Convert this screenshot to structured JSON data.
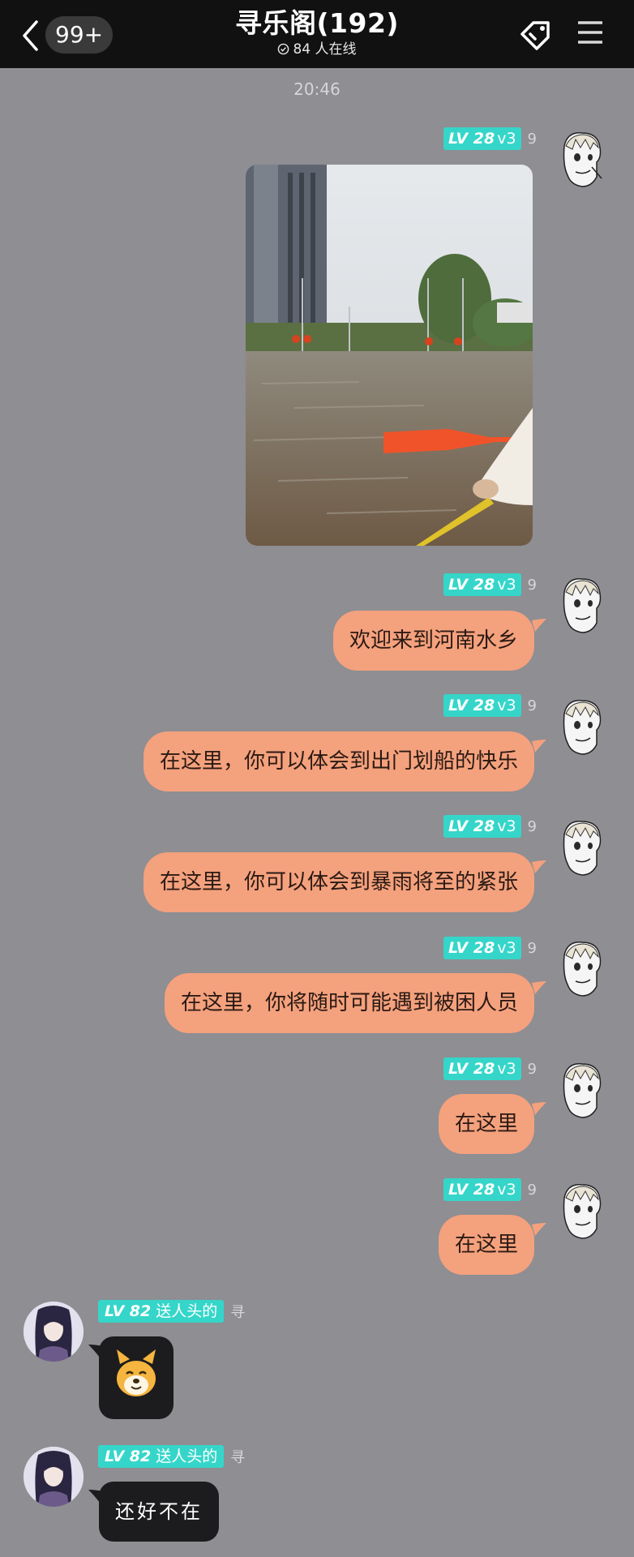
{
  "header": {
    "unread_badge": "99+",
    "title": "寻乐阁(192)",
    "online_text": "84 人在线"
  },
  "timestamp": "20:46",
  "sender_right": {
    "level": "LV 28",
    "sub": "v3",
    "num": "9"
  },
  "messages_right": [
    {
      "type": "image",
      "alt": "flooded street photo"
    },
    {
      "type": "text",
      "text": "欢迎来到河南水乡"
    },
    {
      "type": "text",
      "text": "在这里，你可以体会到出门划船的快乐"
    },
    {
      "type": "text",
      "text": "在这里，你可以体会到暴雨将至的紧张"
    },
    {
      "type": "text",
      "text": "在这里，你将随时可能遇到被困人员"
    },
    {
      "type": "text",
      "text": "在这里"
    },
    {
      "type": "text",
      "text": "在这里"
    }
  ],
  "sender_left": {
    "level": "LV 82",
    "name": "送人头的",
    "tag": "寻"
  },
  "messages_left": [
    {
      "type": "emoji",
      "name": "shiba-dog-emoji"
    },
    {
      "type": "text",
      "text": "还好不在"
    }
  ],
  "colors": {
    "background": "#8e8e93",
    "topbar": "#111111",
    "bubble_right": "#f4a17d",
    "bubble_left": "#1c1c1e",
    "badge": "#35d6c9"
  }
}
